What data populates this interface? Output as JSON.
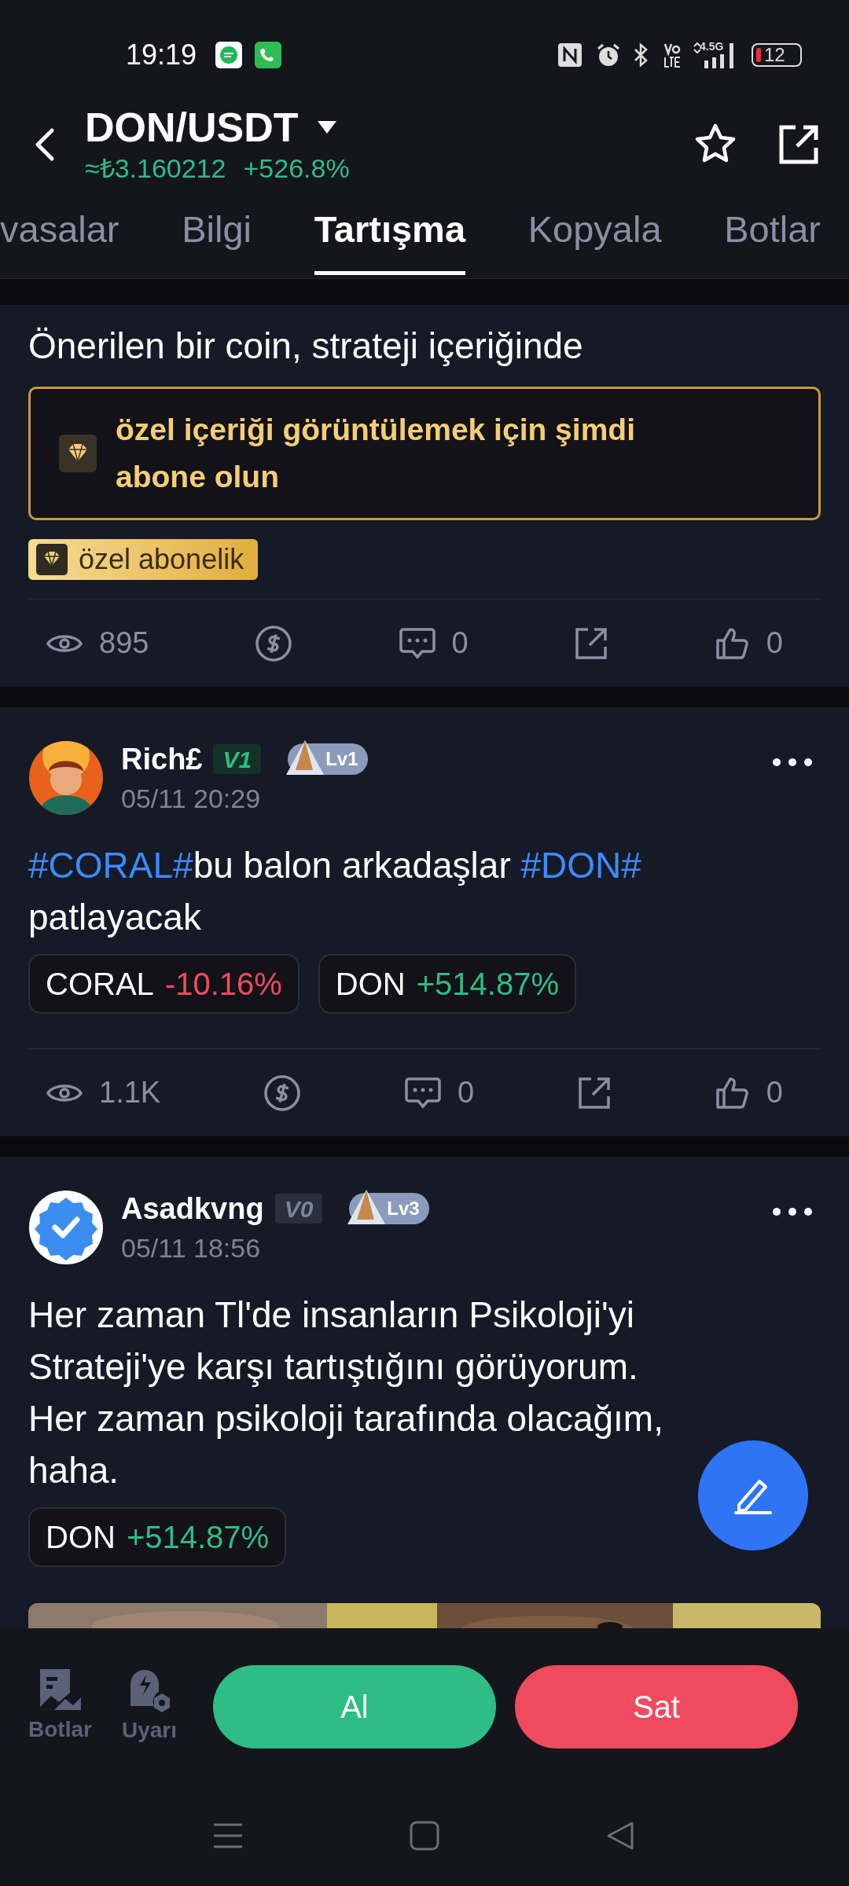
{
  "status_bar": {
    "time": "19:19",
    "network": "4.5G",
    "battery": "12"
  },
  "header": {
    "pair": "DON/USDT",
    "price": "≈₺3.160212",
    "change": "+526.8%"
  },
  "tabs": [
    {
      "label": "vasalar",
      "selected": false
    },
    {
      "label": "Bilgi",
      "selected": false
    },
    {
      "label": "Tartışma",
      "selected": true
    },
    {
      "label": "Kopyala",
      "selected": false
    },
    {
      "label": "Botlar",
      "selected": false
    }
  ],
  "posts": [
    {
      "kind": "locked",
      "title": "Önerilen bir coin, strateji içeriğinde",
      "lock_message": "özel içeriği görüntülemek için şimdi abone olun",
      "badge": "özel abonelik",
      "stats": {
        "views": "895",
        "comments": "0",
        "likes": "0"
      }
    },
    {
      "kind": "user",
      "avatar": {
        "kind": "cartoon"
      },
      "author": "Rich£",
      "vip": "V1",
      "vip_active": true,
      "level": "Lv1",
      "time": "05/11 20:29",
      "segments": [
        {
          "kind": "hashtag",
          "text": "#CORAL#"
        },
        {
          "kind": "plain",
          "text": "bu balon arkadaşlar "
        },
        {
          "kind": "hashtag",
          "text": "#DON#"
        },
        {
          "kind": "plain",
          "text": " patlayacak"
        }
      ],
      "tags": [
        {
          "symbol": "CORAL",
          "change": "-10.16%",
          "kind": "loss"
        },
        {
          "symbol": "DON",
          "change": "+514.87%",
          "kind": "gain"
        }
      ],
      "stats": {
        "views": "1.1K",
        "comments": "0",
        "likes": "0"
      }
    },
    {
      "kind": "user",
      "avatar": {
        "kind": "verified"
      },
      "author": "Asadkvng",
      "vip": "V0",
      "vip_active": false,
      "level": "Lv3",
      "time": "05/11 18:56",
      "segments": [
        {
          "kind": "plain",
          "text": "Her zaman Tl'de insanların Psikoloji'yi Strateji'ye karşı tartıştığını görüyorum. Her zaman psikoloji tarafında olacağım, haha."
        }
      ],
      "tags": [
        {
          "symbol": "DON",
          "change": "+514.87%",
          "kind": "gain"
        }
      ],
      "media": {
        "kind": "picture"
      }
    }
  ],
  "bottom_bar": {
    "items": [
      {
        "label": "Botlar",
        "kind": "bots"
      },
      {
        "label": "Uyarı",
        "kind": "alerts"
      }
    ],
    "buy": "Al",
    "sell": "Sat"
  }
}
